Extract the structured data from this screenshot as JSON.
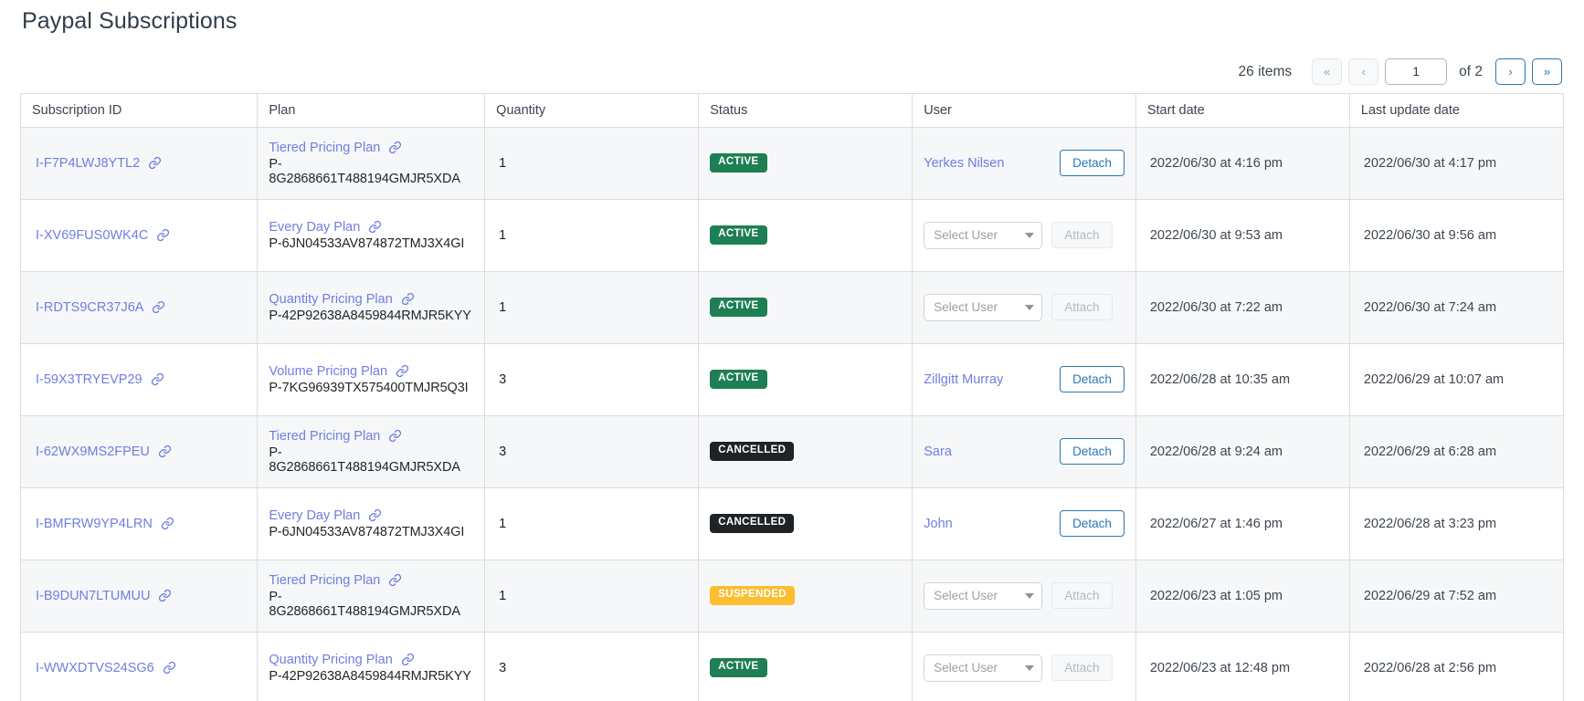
{
  "page": {
    "title": "Paypal Subscriptions"
  },
  "pagination": {
    "items_label": "26 items",
    "first_label": "«",
    "prev_label": "‹",
    "current_page": "1",
    "of_label": "of 2",
    "next_label": "›",
    "last_label": "»"
  },
  "table": {
    "columns": [
      "Subscription ID",
      "Plan",
      "Quantity",
      "Status",
      "User",
      "Start date",
      "Last update date"
    ],
    "rows": [
      {
        "subscription_id": "I-F7P4LWJ8YTL2",
        "plan_name": "Tiered Pricing Plan",
        "plan_id": "P-8G2868661T488194GMJR5XDA",
        "quantity": "1",
        "status": "ACTIVE",
        "user_name": "Yerkes Nilsen",
        "user_action": "Detach",
        "user_attached": true,
        "start_date": "2022/06/30 at 4:16 pm",
        "last_update_date": "2022/06/30 at 4:17 pm"
      },
      {
        "subscription_id": "I-XV69FUS0WK4C",
        "plan_name": "Every Day Plan",
        "plan_id": "P-6JN04533AV874872TMJ3X4GI",
        "quantity": "1",
        "status": "ACTIVE",
        "user_placeholder": "Select User",
        "user_action": "Attach",
        "user_attached": false,
        "start_date": "2022/06/30 at 9:53 am",
        "last_update_date": "2022/06/30 at 9:56 am"
      },
      {
        "subscription_id": "I-RDTS9CR37J6A",
        "plan_name": "Quantity Pricing Plan",
        "plan_id": "P-42P92638A8459844RMJR5KYY",
        "quantity": "1",
        "status": "ACTIVE",
        "user_placeholder": "Select User",
        "user_action": "Attach",
        "user_attached": false,
        "start_date": "2022/06/30 at 7:22 am",
        "last_update_date": "2022/06/30 at 7:24 am"
      },
      {
        "subscription_id": "I-59X3TRYEVP29",
        "plan_name": "Volume Pricing Plan",
        "plan_id": "P-7KG96939TX575400TMJR5Q3I",
        "quantity": "3",
        "status": "ACTIVE",
        "user_name": "Zillgitt Murray",
        "user_action": "Detach",
        "user_attached": true,
        "start_date": "2022/06/28 at 10:35 am",
        "last_update_date": "2022/06/29 at 10:07 am"
      },
      {
        "subscription_id": "I-62WX9MS2FPEU",
        "plan_name": "Tiered Pricing Plan",
        "plan_id": "P-8G2868661T488194GMJR5XDA",
        "quantity": "3",
        "status": "CANCELLED",
        "user_name": "Sara",
        "user_action": "Detach",
        "user_attached": true,
        "start_date": "2022/06/28 at 9:24 am",
        "last_update_date": "2022/06/29 at 6:28 am"
      },
      {
        "subscription_id": "I-BMFRW9YP4LRN",
        "plan_name": "Every Day Plan",
        "plan_id": "P-6JN04533AV874872TMJ3X4GI",
        "quantity": "1",
        "status": "CANCELLED",
        "user_name": "John",
        "user_action": "Detach",
        "user_attached": true,
        "start_date": "2022/06/27 at 1:46 pm",
        "last_update_date": "2022/06/28 at 3:23 pm"
      },
      {
        "subscription_id": "I-B9DUN7LTUMUU",
        "plan_name": "Tiered Pricing Plan",
        "plan_id": "P-8G2868661T488194GMJR5XDA",
        "quantity": "1",
        "status": "SUSPENDED",
        "user_placeholder": "Select User",
        "user_action": "Attach",
        "user_attached": false,
        "start_date": "2022/06/23 at 1:05 pm",
        "last_update_date": "2022/06/29 at 7:52 am"
      },
      {
        "subscription_id": "I-WWXDTVS24SG6",
        "plan_name": "Quantity Pricing Plan",
        "plan_id": "P-42P92638A8459844RMJR5KYY",
        "quantity": "3",
        "status": "ACTIVE",
        "user_placeholder": "Select User",
        "user_action": "Attach",
        "user_attached": false,
        "start_date": "2022/06/23 at 12:48 pm",
        "last_update_date": "2022/06/28 at 2:56 pm"
      }
    ]
  },
  "colors": {
    "link": "#6f7ee0",
    "active_badge": "#1e7e54",
    "cancelled_badge": "#1f2326",
    "suspended_badge": "#fcbd30",
    "primary_button": "#2878b8"
  }
}
